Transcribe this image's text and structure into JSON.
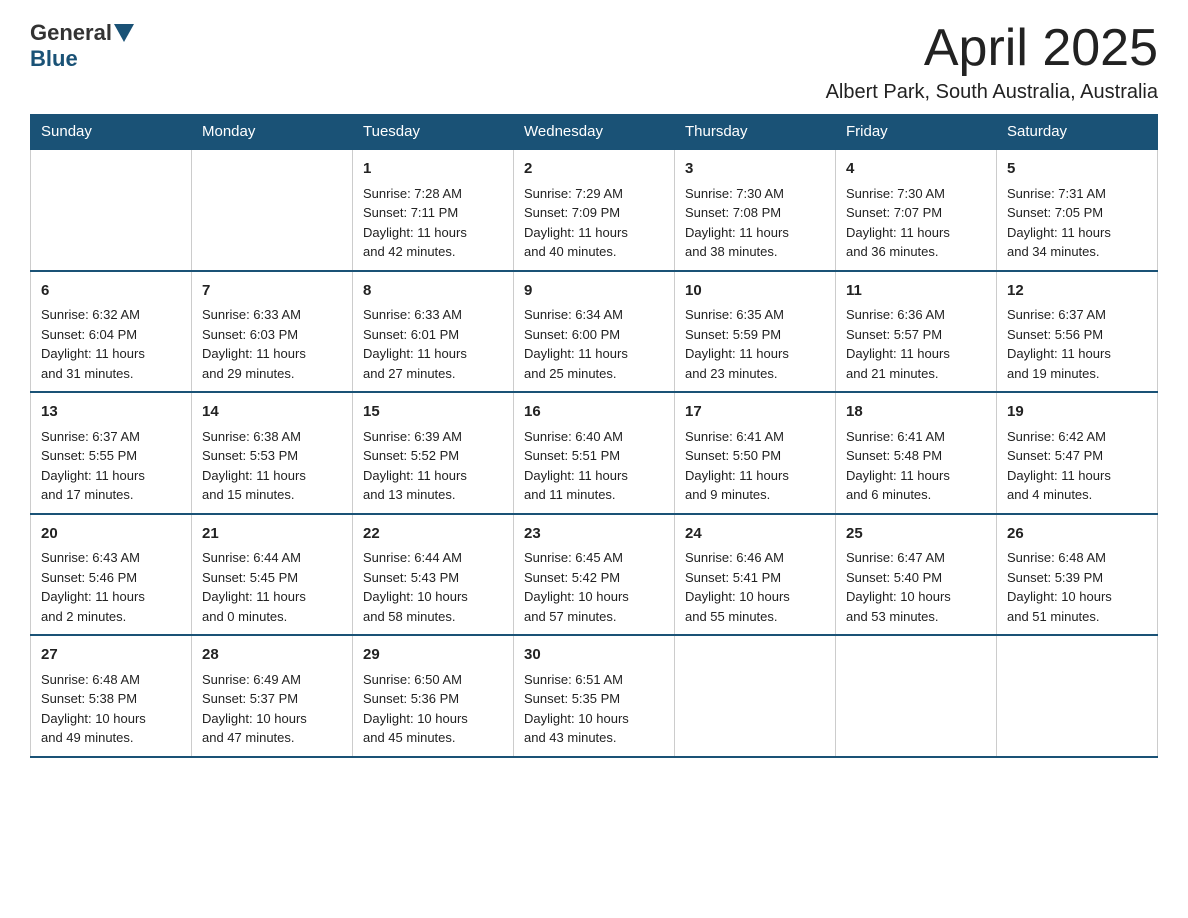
{
  "header": {
    "logo": {
      "general": "General",
      "blue": "Blue"
    },
    "title": "April 2025",
    "location": "Albert Park, South Australia, Australia"
  },
  "weekdays": [
    "Sunday",
    "Monday",
    "Tuesday",
    "Wednesday",
    "Thursday",
    "Friday",
    "Saturday"
  ],
  "weeks": [
    [
      {
        "day": "",
        "info": ""
      },
      {
        "day": "",
        "info": ""
      },
      {
        "day": "1",
        "info": "Sunrise: 7:28 AM\nSunset: 7:11 PM\nDaylight: 11 hours\nand 42 minutes."
      },
      {
        "day": "2",
        "info": "Sunrise: 7:29 AM\nSunset: 7:09 PM\nDaylight: 11 hours\nand 40 minutes."
      },
      {
        "day": "3",
        "info": "Sunrise: 7:30 AM\nSunset: 7:08 PM\nDaylight: 11 hours\nand 38 minutes."
      },
      {
        "day": "4",
        "info": "Sunrise: 7:30 AM\nSunset: 7:07 PM\nDaylight: 11 hours\nand 36 minutes."
      },
      {
        "day": "5",
        "info": "Sunrise: 7:31 AM\nSunset: 7:05 PM\nDaylight: 11 hours\nand 34 minutes."
      }
    ],
    [
      {
        "day": "6",
        "info": "Sunrise: 6:32 AM\nSunset: 6:04 PM\nDaylight: 11 hours\nand 31 minutes."
      },
      {
        "day": "7",
        "info": "Sunrise: 6:33 AM\nSunset: 6:03 PM\nDaylight: 11 hours\nand 29 minutes."
      },
      {
        "day": "8",
        "info": "Sunrise: 6:33 AM\nSunset: 6:01 PM\nDaylight: 11 hours\nand 27 minutes."
      },
      {
        "day": "9",
        "info": "Sunrise: 6:34 AM\nSunset: 6:00 PM\nDaylight: 11 hours\nand 25 minutes."
      },
      {
        "day": "10",
        "info": "Sunrise: 6:35 AM\nSunset: 5:59 PM\nDaylight: 11 hours\nand 23 minutes."
      },
      {
        "day": "11",
        "info": "Sunrise: 6:36 AM\nSunset: 5:57 PM\nDaylight: 11 hours\nand 21 minutes."
      },
      {
        "day": "12",
        "info": "Sunrise: 6:37 AM\nSunset: 5:56 PM\nDaylight: 11 hours\nand 19 minutes."
      }
    ],
    [
      {
        "day": "13",
        "info": "Sunrise: 6:37 AM\nSunset: 5:55 PM\nDaylight: 11 hours\nand 17 minutes."
      },
      {
        "day": "14",
        "info": "Sunrise: 6:38 AM\nSunset: 5:53 PM\nDaylight: 11 hours\nand 15 minutes."
      },
      {
        "day": "15",
        "info": "Sunrise: 6:39 AM\nSunset: 5:52 PM\nDaylight: 11 hours\nand 13 minutes."
      },
      {
        "day": "16",
        "info": "Sunrise: 6:40 AM\nSunset: 5:51 PM\nDaylight: 11 hours\nand 11 minutes."
      },
      {
        "day": "17",
        "info": "Sunrise: 6:41 AM\nSunset: 5:50 PM\nDaylight: 11 hours\nand 9 minutes."
      },
      {
        "day": "18",
        "info": "Sunrise: 6:41 AM\nSunset: 5:48 PM\nDaylight: 11 hours\nand 6 minutes."
      },
      {
        "day": "19",
        "info": "Sunrise: 6:42 AM\nSunset: 5:47 PM\nDaylight: 11 hours\nand 4 minutes."
      }
    ],
    [
      {
        "day": "20",
        "info": "Sunrise: 6:43 AM\nSunset: 5:46 PM\nDaylight: 11 hours\nand 2 minutes."
      },
      {
        "day": "21",
        "info": "Sunrise: 6:44 AM\nSunset: 5:45 PM\nDaylight: 11 hours\nand 0 minutes."
      },
      {
        "day": "22",
        "info": "Sunrise: 6:44 AM\nSunset: 5:43 PM\nDaylight: 10 hours\nand 58 minutes."
      },
      {
        "day": "23",
        "info": "Sunrise: 6:45 AM\nSunset: 5:42 PM\nDaylight: 10 hours\nand 57 minutes."
      },
      {
        "day": "24",
        "info": "Sunrise: 6:46 AM\nSunset: 5:41 PM\nDaylight: 10 hours\nand 55 minutes."
      },
      {
        "day": "25",
        "info": "Sunrise: 6:47 AM\nSunset: 5:40 PM\nDaylight: 10 hours\nand 53 minutes."
      },
      {
        "day": "26",
        "info": "Sunrise: 6:48 AM\nSunset: 5:39 PM\nDaylight: 10 hours\nand 51 minutes."
      }
    ],
    [
      {
        "day": "27",
        "info": "Sunrise: 6:48 AM\nSunset: 5:38 PM\nDaylight: 10 hours\nand 49 minutes."
      },
      {
        "day": "28",
        "info": "Sunrise: 6:49 AM\nSunset: 5:37 PM\nDaylight: 10 hours\nand 47 minutes."
      },
      {
        "day": "29",
        "info": "Sunrise: 6:50 AM\nSunset: 5:36 PM\nDaylight: 10 hours\nand 45 minutes."
      },
      {
        "day": "30",
        "info": "Sunrise: 6:51 AM\nSunset: 5:35 PM\nDaylight: 10 hours\nand 43 minutes."
      },
      {
        "day": "",
        "info": ""
      },
      {
        "day": "",
        "info": ""
      },
      {
        "day": "",
        "info": ""
      }
    ]
  ]
}
